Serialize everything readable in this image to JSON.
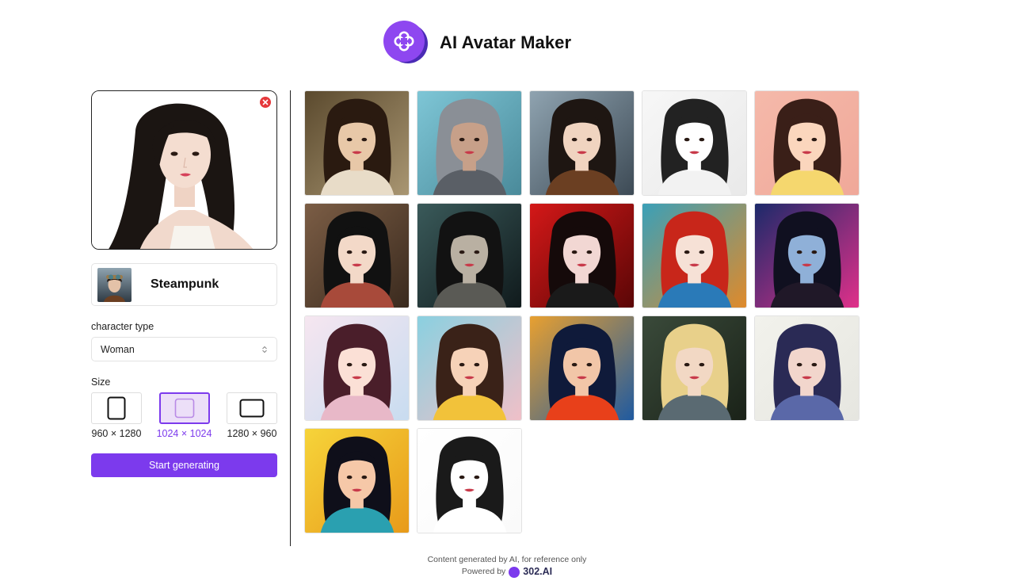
{
  "header": {
    "title": "AI Avatar Maker",
    "logo_icon": "clover-icon",
    "accent": "#8e47f0"
  },
  "upload": {
    "has_image": true,
    "remove_icon": "close-circle-icon"
  },
  "style": {
    "name": "Steampunk"
  },
  "character_type": {
    "label": "character type",
    "value": "Woman"
  },
  "size": {
    "label": "Size",
    "selected": "1024 × 1024",
    "options": [
      {
        "label": "960 × 1280",
        "shape": "portrait"
      },
      {
        "label": "1024 × 1024",
        "shape": "square"
      },
      {
        "label": "1280 × 960",
        "shape": "landscape"
      }
    ]
  },
  "actions": {
    "generate_label": "Start generating",
    "accent": "#7c3aed"
  },
  "styles_gallery": [
    {
      "bg": [
        "#5b4a2e",
        "#a99672"
      ],
      "hair": "#2a1a10",
      "skin": "#e8c8a8",
      "shirt": "#e8dcc8"
    },
    {
      "bg": [
        "#7ec6d6",
        "#4a8a9a"
      ],
      "hair": "#8a8f96",
      "skin": "#c7a089",
      "shirt": "#5a5f66"
    },
    {
      "bg": [
        "#8fa3b0",
        "#3d4a55"
      ],
      "hair": "#1e1612",
      "skin": "#f0d4c0",
      "shirt": "#6b3f22"
    },
    {
      "bg": [
        "#f7f7f7",
        "#e9e9e9"
      ],
      "hair": "#222222",
      "skin": "#ffffff",
      "shirt": "#f2f2f2"
    },
    {
      "bg": [
        "#f5b9aa",
        "#f0a899"
      ],
      "hair": "#3a1f18",
      "skin": "#fbd6bd",
      "shirt": "#f5d76e"
    },
    {
      "bg": [
        "#7b5d45",
        "#3a2a1e"
      ],
      "hair": "#111111",
      "skin": "#f3d9c8",
      "shirt": "#a84a3a"
    },
    {
      "bg": [
        "#3a5a5a",
        "#101a1c"
      ],
      "hair": "#121212",
      "skin": "#b9b0a2",
      "shirt": "#5a5a55"
    },
    {
      "bg": [
        "#d41818",
        "#5a0606"
      ],
      "hair": "#150a0a",
      "skin": "#f2d7d3",
      "shirt": "#1a1a1a"
    },
    {
      "bg": [
        "#3aa0b8",
        "#e08a2a"
      ],
      "hair": "#c8261a",
      "skin": "#f6e1d6",
      "shirt": "#2a7ab8"
    },
    {
      "bg": [
        "#1c2a6a",
        "#e0308a"
      ],
      "hair": "#101020",
      "skin": "#8fb0d8",
      "shirt": "#201828"
    },
    {
      "bg": [
        "#f6e6f0",
        "#c8dcf0"
      ],
      "hair": "#4a1e2a",
      "skin": "#fbe0d6",
      "shirt": "#e8b8c8"
    },
    {
      "bg": [
        "#8ad0e0",
        "#f0c0c8"
      ],
      "hair": "#3a2218",
      "skin": "#f6d2b8",
      "shirt": "#f2c23a"
    },
    {
      "bg": [
        "#e8a030",
        "#1f5aa0"
      ],
      "hair": "#0f1a3a",
      "skin": "#f2c6a8",
      "shirt": "#e8401a"
    },
    {
      "bg": [
        "#3a4a3a",
        "#1a2218"
      ],
      "hair": "#e8d08a",
      "skin": "#f2d8c4",
      "shirt": "#5a6a72"
    },
    {
      "bg": [
        "#f2f2ec",
        "#e6e6e0"
      ],
      "hair": "#2a2a55",
      "skin": "#f2d6cc",
      "shirt": "#5a68a8"
    },
    {
      "bg": [
        "#f6d43a",
        "#e89a1a"
      ],
      "hair": "#0f0f1a",
      "skin": "#f6c8a8",
      "shirt": "#2aa0b0"
    },
    {
      "bg": [
        "#ffffff",
        "#fafafa"
      ],
      "hair": "#1a1a1a",
      "skin": "#ffffff",
      "shirt": "#ffffff"
    }
  ],
  "footer": {
    "disclaimer": "Content generated by AI, for reference only",
    "powered_by": "Powered by",
    "brand": "302.AI"
  }
}
